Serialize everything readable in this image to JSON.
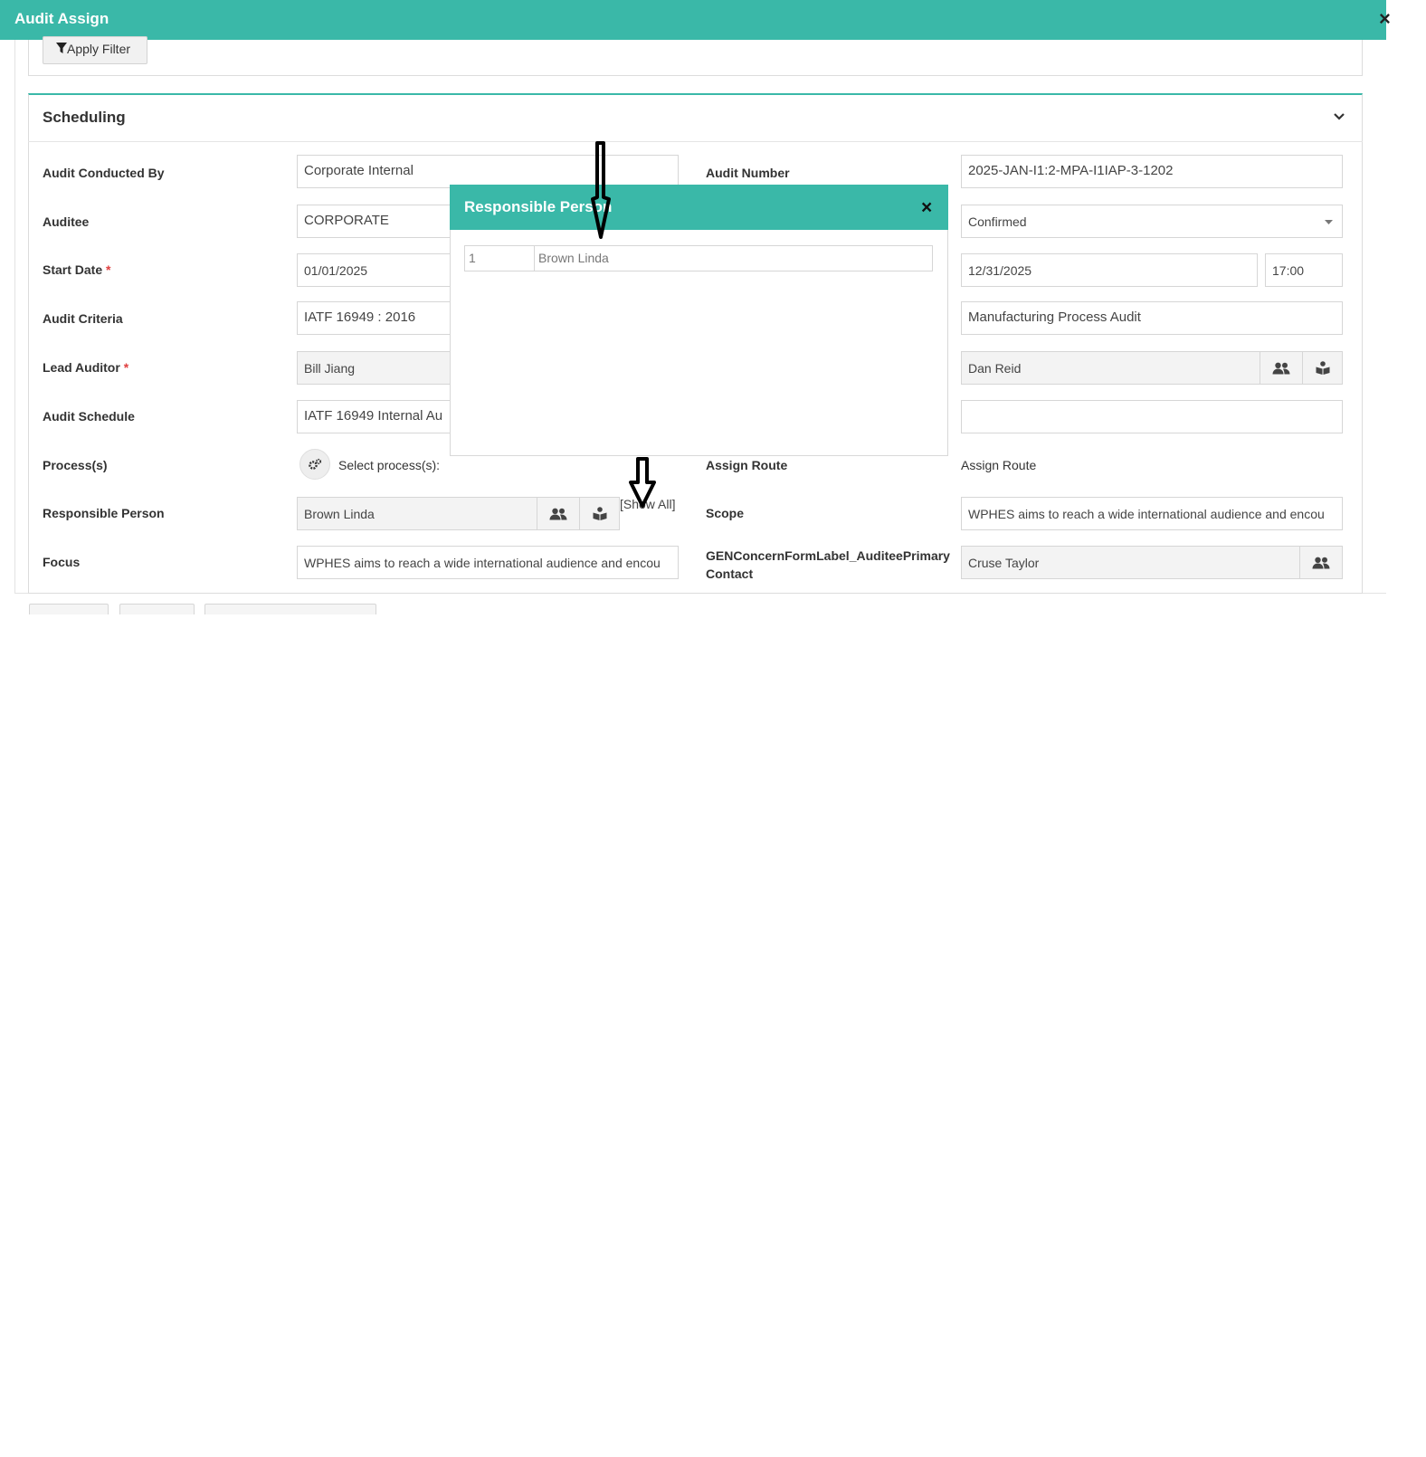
{
  "window": {
    "title": "Audit Assign",
    "close_glyph": "×"
  },
  "filter": {
    "apply_label": "Apply Filter",
    "icon": "filter-icon"
  },
  "section": {
    "title": "Scheduling",
    "toggle_icon": "chevron-down-icon"
  },
  "left": {
    "audit_conducted_by": {
      "label": "Audit Conducted By",
      "value": "Corporate Internal"
    },
    "auditee": {
      "label": "Auditee",
      "value": "CORPORATE"
    },
    "start_date": {
      "label": "Start Date",
      "required_mark": "*",
      "value": "01/01/2025"
    },
    "audit_criteria": {
      "label": "Audit Criteria",
      "value": "IATF 16949 : 2016"
    },
    "lead_auditor": {
      "label": "Lead Auditor",
      "required_mark": "*",
      "value": "Bill  Jiang"
    },
    "audit_schedule": {
      "label": "Audit Schedule",
      "value": "IATF 16949 Internal Au"
    },
    "processes": {
      "label": "Process(s)",
      "placeholder": "Select process(s):",
      "icon": "gears-icon"
    },
    "responsible_person": {
      "label": "Responsible Person",
      "value": "Brown Linda",
      "show_all": "[Show All]",
      "icons": [
        "users-icon",
        "book-reader-icon"
      ]
    },
    "focus": {
      "label": "Focus",
      "value": "WPHES aims to reach a wide international audience and encou"
    }
  },
  "right": {
    "audit_number": {
      "label": "Audit Number",
      "value": "2025-JAN-I1:2-MPA-I1IAP-3-1202"
    },
    "status": {
      "value": "Confirmed"
    },
    "end_date": {
      "value": "12/31/2025",
      "time": "17:00"
    },
    "audit_type": {
      "value": "Manufacturing Process Audit"
    },
    "auditor": {
      "value": "Dan  Reid",
      "icons": [
        "users-icon",
        "book-reader-icon"
      ]
    },
    "blank_field": {
      "value": ""
    },
    "assign_route": {
      "label": "Assign Route",
      "value": "Assign Route"
    },
    "scope": {
      "label": "Scope",
      "value": "WPHES aims to reach a wide international audience and encou"
    },
    "primary_contact": {
      "label": "GENConcernFormLabel_AuditeePrimaryContact",
      "value": "Cruse Taylor",
      "icon": "users-icon"
    }
  },
  "popup": {
    "title": "Responsible Person",
    "close_glyph": "×",
    "rows": [
      {
        "num": "1",
        "name": "Brown Linda"
      }
    ]
  },
  "colors": {
    "accent": "#3ab8a8",
    "required": "#e04040"
  }
}
